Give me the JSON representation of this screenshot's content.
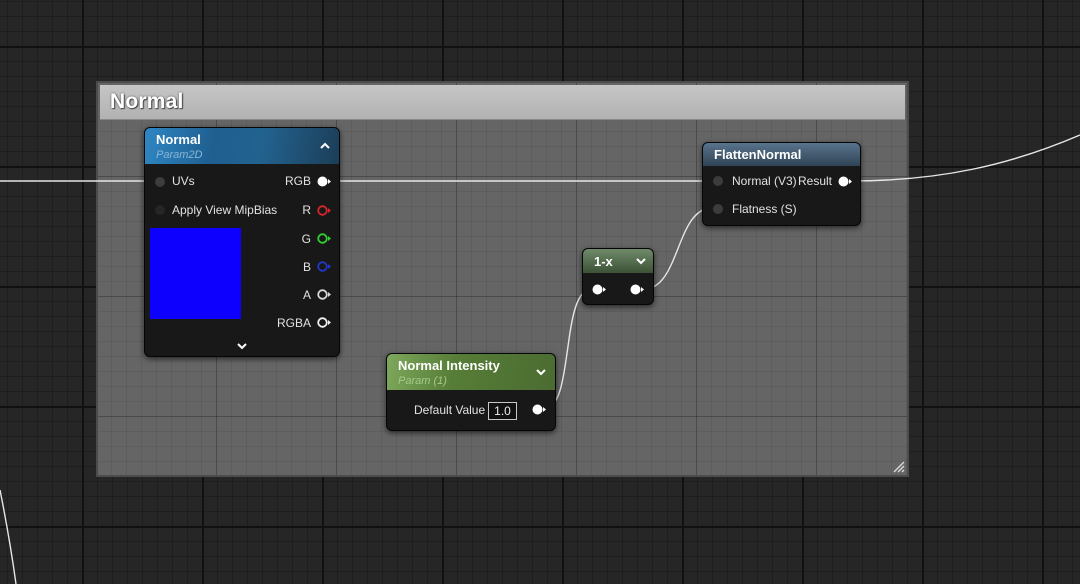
{
  "comment": {
    "title": "Normal"
  },
  "nodes": {
    "texture": {
      "title": "Normal",
      "subtitle": "Param2D",
      "inputs": [
        "UVs",
        "Apply View MipBias"
      ],
      "outputs": [
        "RGB",
        "R",
        "G",
        "B",
        "A",
        "RGBA"
      ],
      "preview_color": "#0d00ff"
    },
    "flatten": {
      "title": "FlattenNormal",
      "inputs": [
        "Normal (V3)",
        "Flatness (S)"
      ],
      "output": "Result"
    },
    "one_minus": {
      "title": "1-x"
    },
    "intensity": {
      "title": "Normal Intensity",
      "subtitle": "Param (1)",
      "default_label": "Default Value",
      "default_value": "1.0"
    }
  },
  "colors": {
    "pin_r": "#d8262a",
    "pin_g": "#2fd02f",
    "pin_b": "#2236c8",
    "wire": "#e6e6e6"
  }
}
